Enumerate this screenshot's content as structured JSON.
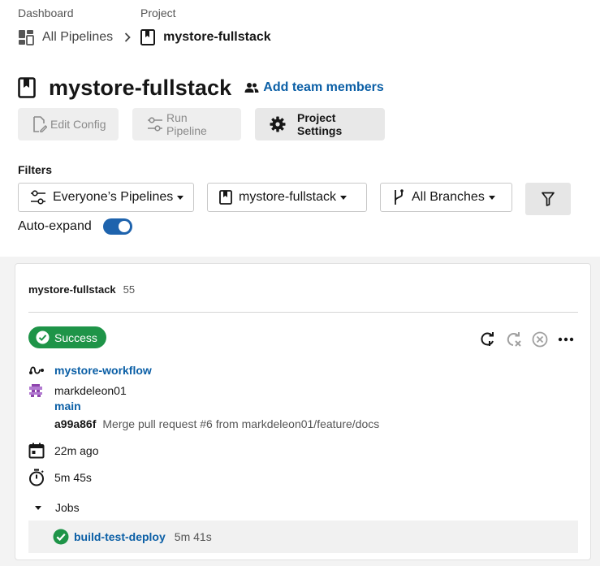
{
  "breadcrumb": {
    "dashboard_label": "Dashboard",
    "project_label": "Project",
    "all_pipelines": "All Pipelines",
    "current_project": "mystore-fullstack"
  },
  "header": {
    "title": "mystore-fullstack",
    "add_team": "Add team members"
  },
  "toolbar": {
    "edit_config": "Edit Config",
    "run_pipeline": "Run Pipeline",
    "project_settings": "Project Settings"
  },
  "filters": {
    "label": "Filters",
    "pipelines": "Everyone’s Pipelines",
    "project": "mystore-fullstack",
    "branches": "All Branches"
  },
  "auto_expand": {
    "label": "Auto-expand",
    "enabled": true
  },
  "pipeline": {
    "project": "mystore-fullstack",
    "number": "55",
    "status": "Success",
    "workflow": "mystore-workflow",
    "author": "markdeleon01",
    "branch": "main",
    "commit_sha": "a99a86f",
    "commit_message": "Merge pull request #6 from markdeleon01/feature/docs",
    "time_ago": "22m ago",
    "duration": "5m 45s",
    "jobs_label": "Jobs",
    "jobs": [
      {
        "name": "build-test-deploy",
        "duration": "5m 41s",
        "status": "success"
      }
    ]
  },
  "colors": {
    "success": "#1e9448",
    "link": "#0b5fa6",
    "toggle": "#1e63ad"
  }
}
